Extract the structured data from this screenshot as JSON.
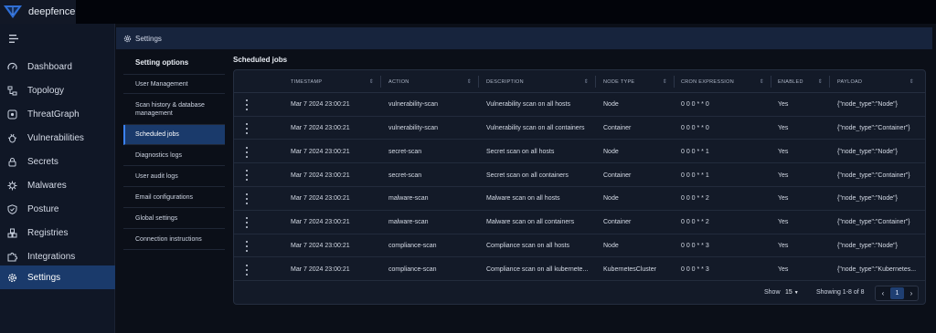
{
  "app": {
    "name": "deepfence"
  },
  "nav": {
    "items": [
      {
        "label": "Dashboard",
        "icon": "dashboard-icon"
      },
      {
        "label": "Topology",
        "icon": "topology-icon"
      },
      {
        "label": "ThreatGraph",
        "icon": "threatgraph-icon"
      },
      {
        "label": "Vulnerabilities",
        "icon": "bug-icon"
      },
      {
        "label": "Secrets",
        "icon": "lock-icon"
      },
      {
        "label": "Malwares",
        "icon": "virus-icon"
      },
      {
        "label": "Posture",
        "icon": "shield-icon"
      },
      {
        "label": "Registries",
        "icon": "registry-icon"
      },
      {
        "label": "Integrations",
        "icon": "puzzle-icon"
      },
      {
        "label": "Settings",
        "icon": "gear-icon",
        "active": true
      }
    ]
  },
  "header": {
    "title": "Settings"
  },
  "settings_menu": {
    "title": "Setting options",
    "items": [
      {
        "label": "User Management"
      },
      {
        "label": "Scan history & database management"
      },
      {
        "label": "Scheduled jobs",
        "active": true
      },
      {
        "label": "Diagnostics logs"
      },
      {
        "label": "User audit logs"
      },
      {
        "label": "Email configurations"
      },
      {
        "label": "Global settings"
      },
      {
        "label": "Connection instructions"
      }
    ]
  },
  "main": {
    "title": "Scheduled jobs",
    "columns": [
      "TIMESTAMP",
      "ACTION",
      "DESCRIPTION",
      "NODE TYPE",
      "CRON EXPRESSION",
      "ENABLED",
      "PAYLOAD"
    ],
    "rows": [
      [
        "Mar 7 2024 23:00:21",
        "vulnerability-scan",
        "Vulnerability scan on all hosts",
        "Node",
        "0 0 0 * * 0",
        "Yes",
        "{\"node_type\":\"Node\"}"
      ],
      [
        "Mar 7 2024 23:00:21",
        "vulnerability-scan",
        "Vulnerability scan on all containers",
        "Container",
        "0 0 0 * * 0",
        "Yes",
        "{\"node_type\":\"Container\"}"
      ],
      [
        "Mar 7 2024 23:00:21",
        "secret-scan",
        "Secret scan on all hosts",
        "Node",
        "0 0 0 * * 1",
        "Yes",
        "{\"node_type\":\"Node\"}"
      ],
      [
        "Mar 7 2024 23:00:21",
        "secret-scan",
        "Secret scan on all containers",
        "Container",
        "0 0 0 * * 1",
        "Yes",
        "{\"node_type\":\"Container\"}"
      ],
      [
        "Mar 7 2024 23:00:21",
        "malware-scan",
        "Malware scan on all hosts",
        "Node",
        "0 0 0 * * 2",
        "Yes",
        "{\"node_type\":\"Node\"}"
      ],
      [
        "Mar 7 2024 23:00:21",
        "malware-scan",
        "Malware scan on all containers",
        "Container",
        "0 0 0 * * 2",
        "Yes",
        "{\"node_type\":\"Container\"}"
      ],
      [
        "Mar 7 2024 23:00:21",
        "compliance-scan",
        "Compliance scan on all hosts",
        "Node",
        "0 0 0 * * 3",
        "Yes",
        "{\"node_type\":\"Node\"}"
      ],
      [
        "Mar 7 2024 23:00:21",
        "compliance-scan",
        "Compliance scan on all kubernete...",
        "KubernetesCluster",
        "0 0 0 * * 3",
        "Yes",
        "{\"node_type\":\"Kubernetes..."
      ]
    ],
    "pagination": {
      "show_label": "Show",
      "page_size": "15",
      "showing_text": "Showing 1-8 of 8",
      "current_page": "1"
    }
  },
  "colors": {
    "accent": "#1a3a6b",
    "header": "#17243d",
    "background": "#0b0f18"
  }
}
